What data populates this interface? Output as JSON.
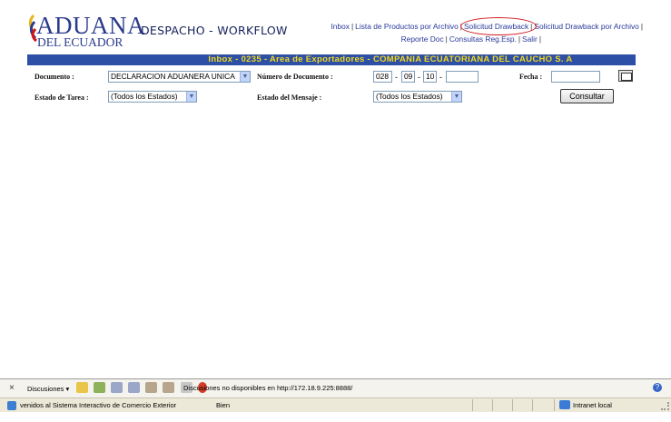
{
  "header": {
    "logo_line1": "ADUANA",
    "logo_line2": "DEL ECUADOR",
    "app_title": "DESPACHO - WORKFLOW"
  },
  "nav": {
    "row1": [
      "Inbox",
      "Lista de Productos por Archivo",
      "Solicitud Drawback",
      "Solicitud Drawback por Archivo"
    ],
    "row2": [
      "Reporte Doc",
      "Consultas Reg.Esp.",
      "Salir"
    ],
    "highlighted": "Solicitud Drawback",
    "highlight_color": "#d0161b"
  },
  "banner": {
    "text": "Inbox - 0235 - Area de Exportadores - COMPANIA ECUATORIANA DEL CAUCHO S. A",
    "bg_color": "#2e4fa6",
    "text_color": "#f0d81c"
  },
  "form": {
    "documento_label": "Documento :",
    "documento_value": "DECLARACION ADUANERA UNICA",
    "numero_label": "Número de Documento :",
    "numero_part1": "028",
    "numero_part2": "09",
    "numero_part3": "10",
    "numero_part4": "",
    "fecha_label": "Fecha :",
    "fecha_value": "",
    "estado_tarea_label": "Estado de Tarea :",
    "estado_tarea_value": "(Todos los Estados)",
    "estado_mensaje_label": "Estado del Mensaje :",
    "estado_mensaje_value": "(Todos los Estados)",
    "consultar_label": "Consultar"
  },
  "toolbar": {
    "close": "×",
    "discussions_label": "Discusiones ▾",
    "message": "Discusiones no disponibles en http://172.18.9.225:8888/",
    "help": "?"
  },
  "statusbar": {
    "left_text": "venidos al Sistema Interactivo de Comercio Exterior",
    "status": "Bien",
    "zone": "Intranet local"
  },
  "icons": {
    "logo_mark": "ecuador-flag-mark-icon",
    "calendar": "calendar-icon",
    "dropdown": "chevron-down-icon",
    "ie": "ie-page-icon",
    "intranet": "intranet-zone-icon"
  }
}
